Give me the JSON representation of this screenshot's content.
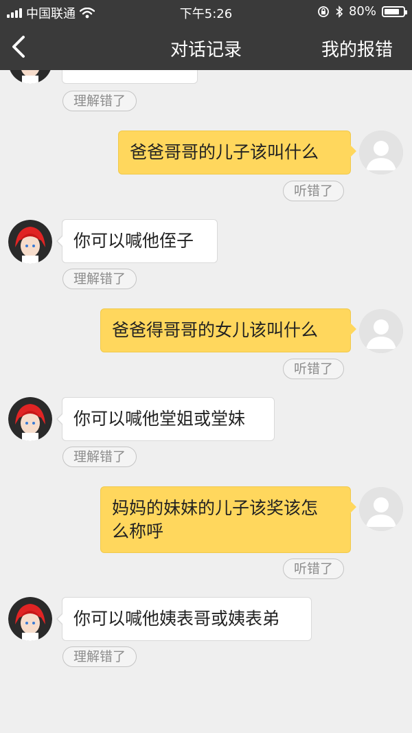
{
  "status_bar": {
    "carrier": "中国联通",
    "time": "下午5:26",
    "battery_percent": "80%",
    "battery_level": 0.8
  },
  "nav": {
    "title": "对话记录",
    "report_label": "我的报错",
    "back_icon": "chevron-left-icon"
  },
  "chat": {
    "messages": [
      {
        "role": "bot",
        "text": "",
        "feedback": "理解错了"
      },
      {
        "role": "user",
        "text": "爸爸哥哥的儿子该叫什么",
        "feedback": "听错了"
      },
      {
        "role": "bot",
        "text": "你可以喊他侄子",
        "feedback": "理解错了"
      },
      {
        "role": "user",
        "text": "爸爸得哥哥的女儿该叫什么",
        "feedback": "听错了"
      },
      {
        "role": "bot",
        "text": "你可以喊他堂姐或堂妹",
        "feedback": "理解错了"
      },
      {
        "role": "user",
        "text_line1": "妈妈的妹妹的儿子该奖该怎",
        "text_line2": "么称呼",
        "feedback": "听错了"
      },
      {
        "role": "bot",
        "text": "你可以喊他姨表哥或姨表弟",
        "feedback": "理解错了"
      }
    ]
  },
  "colors": {
    "bar_bg": "#3a3a3a",
    "chat_bg": "#efefef",
    "user_bubble": "#ffd75d",
    "bot_bubble": "#ffffff",
    "avatar_hair": "#e02424"
  }
}
